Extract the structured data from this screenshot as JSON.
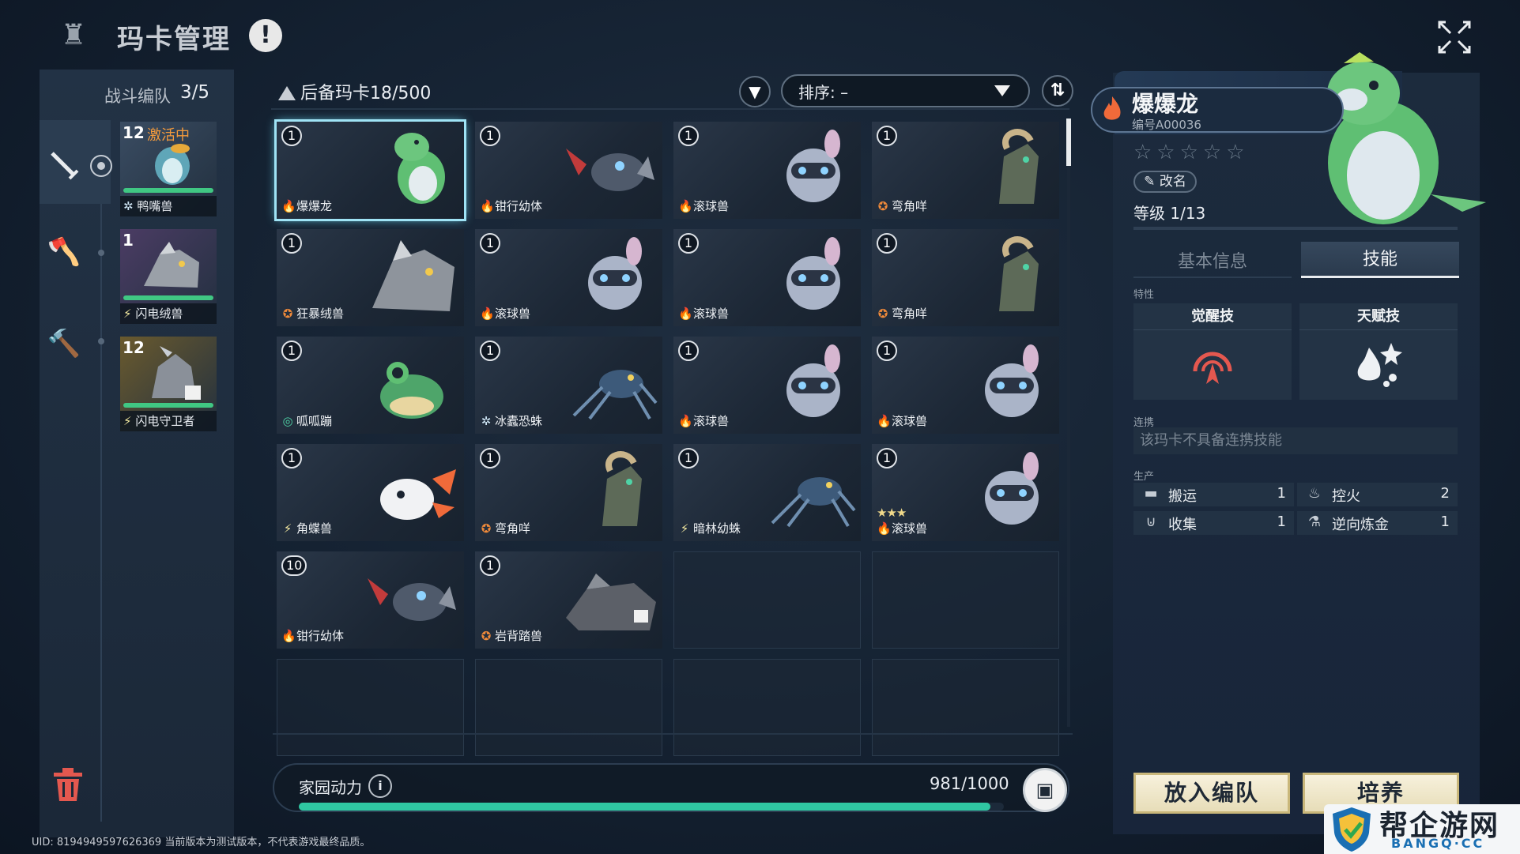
{
  "header": {
    "title": "玛卡管理",
    "info_icon": "!"
  },
  "team": {
    "title": "战斗编队",
    "count": "3/5",
    "members": [
      {
        "level": "12",
        "status": "激活中",
        "name": "鸭嘴兽",
        "element": "ice"
      },
      {
        "level": "1",
        "status": "",
        "name": "闪电绒兽",
        "element": "electric"
      },
      {
        "level": "12",
        "status": "",
        "name": "闪电守卫者",
        "element": "electric"
      }
    ]
  },
  "reserve": {
    "title": "后备玛卡",
    "count": "18/500",
    "sort_label": "排序: –",
    "cards": [
      {
        "level": "1",
        "name": "爆爆龙",
        "element": "fire",
        "icon": "dino-icon",
        "selected": true
      },
      {
        "level": "1",
        "name": "钳行幼体",
        "element": "fire",
        "icon": "crab-mech-icon"
      },
      {
        "level": "1",
        "name": "滚球兽",
        "element": "fire",
        "icon": "ball-beast-icon"
      },
      {
        "level": "1",
        "name": "弯角咩",
        "element": "fighting",
        "icon": "ram-icon"
      },
      {
        "level": "1",
        "name": "狂暴绒兽",
        "element": "fighting",
        "icon": "wild-beast-icon"
      },
      {
        "level": "1",
        "name": "滚球兽",
        "element": "fire",
        "icon": "ball-beast-icon"
      },
      {
        "level": "1",
        "name": "滚球兽",
        "element": "fire",
        "icon": "ball-beast-icon"
      },
      {
        "level": "1",
        "name": "弯角咩",
        "element": "fighting",
        "icon": "ram-icon"
      },
      {
        "level": "1",
        "name": "呱呱蹦",
        "element": "wind",
        "icon": "frog-icon"
      },
      {
        "level": "1",
        "name": "冰蠹恐蛛",
        "element": "ice",
        "icon": "spider-icon"
      },
      {
        "level": "1",
        "name": "滚球兽",
        "element": "fire",
        "icon": "ball-beast-icon"
      },
      {
        "level": "1",
        "name": "滚球兽",
        "element": "fire",
        "icon": "ball-beast-icon"
      },
      {
        "level": "1",
        "name": "角蝶兽",
        "element": "electric",
        "icon": "axolotl-icon"
      },
      {
        "level": "1",
        "name": "弯角咩",
        "element": "fighting",
        "icon": "ram-icon"
      },
      {
        "level": "1",
        "name": "暗林幼蛛",
        "element": "electric",
        "icon": "spider-icon"
      },
      {
        "level": "1",
        "name": "滚球兽",
        "element": "fire",
        "icon": "ball-beast-icon",
        "stars": "★★★"
      },
      {
        "level": "10",
        "name": "钳行幼体",
        "element": "fire",
        "icon": "crab-mech-icon"
      },
      {
        "level": "1",
        "name": "岩背踏兽",
        "element": "fighting",
        "icon": "rock-beast-icon"
      }
    ],
    "empty_slots": 6
  },
  "power": {
    "label": "家园动力",
    "value": "981/1000",
    "fraction": 0.981
  },
  "uid_text": "UID: 8194949597626369 当前版本为测试版本，不代表游戏最终品质。",
  "detail": {
    "name": "爆爆龙",
    "id": "编号A00036",
    "stars": "☆☆☆☆☆",
    "rename": "改名",
    "level": "等级  1/13",
    "tabs": {
      "basic": "基本信息",
      "skill": "技能"
    },
    "trait_label": "特性",
    "awaken_title": "觉醒技",
    "talent_title": "天赋技",
    "link_label": "连携",
    "link_text": "该玛卡不具备连携技能",
    "prod_label": "生产",
    "production": [
      {
        "name": "搬运",
        "value": "1",
        "icon": "box-icon"
      },
      {
        "name": "控火",
        "value": "2",
        "icon": "fire-icon"
      },
      {
        "name": "收集",
        "value": "1",
        "icon": "basket-icon"
      },
      {
        "name": "逆向炼金",
        "value": "1",
        "icon": "flask-icon"
      }
    ],
    "btn_team": "放入编队",
    "btn_train": "培养"
  },
  "watermark": {
    "cn": "帮企游网",
    "en": "BANGQ·CC"
  },
  "colors": {
    "fire": "#f06a3a",
    "ice": "#cfe6f5",
    "electric": "#f3e9a0",
    "fighting": "#f08a3a",
    "wind": "#4fd3a6",
    "hp": "#40c783",
    "power": "#2fc7a2",
    "accent": "#9fe3f5"
  }
}
